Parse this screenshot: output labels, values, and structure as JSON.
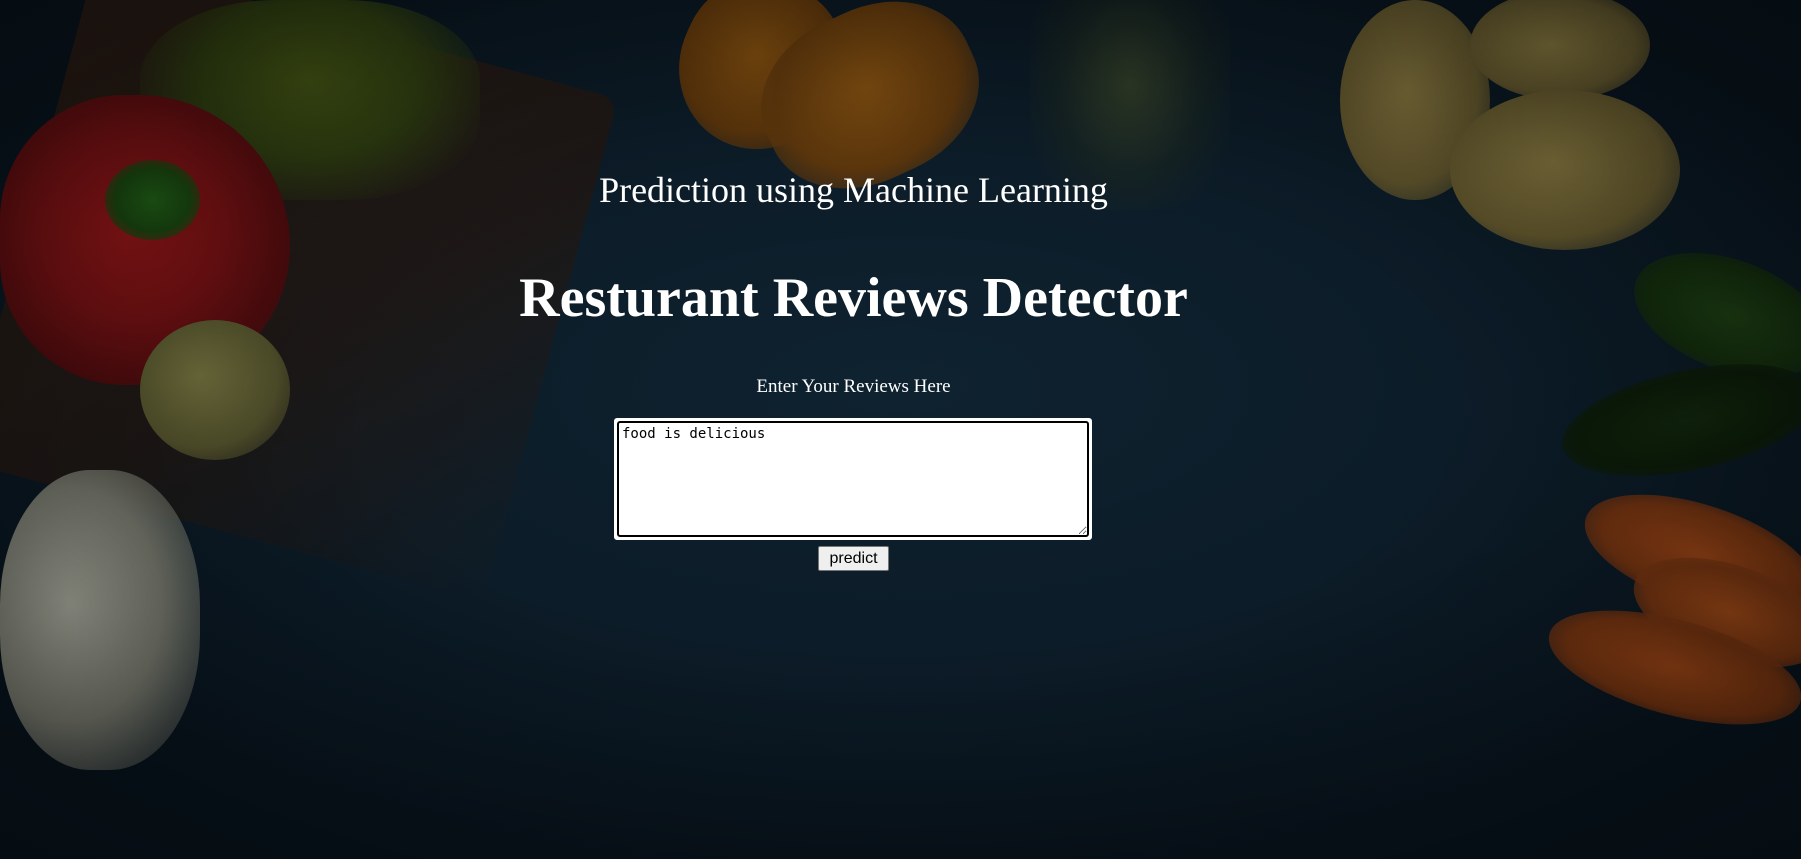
{
  "page": {
    "subtitle": "Prediction using Machine Learning",
    "title": "Resturant Reviews Detector"
  },
  "form": {
    "label": "Enter Your Reviews Here",
    "review_value": "food is delicious",
    "submit_label": "predict"
  },
  "colors": {
    "text": "#ffffff",
    "background": "#0c1c28"
  }
}
